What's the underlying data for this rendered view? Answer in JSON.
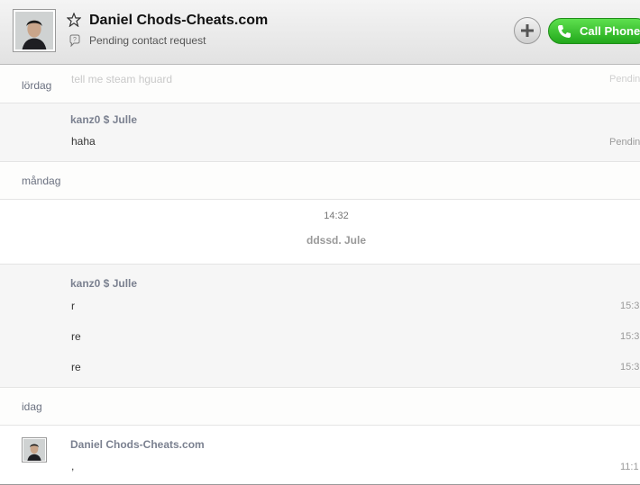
{
  "header": {
    "contact_name": "Daniel Chods-Cheats.com",
    "status": "Pending contact request",
    "call_label": "Call Phone"
  },
  "chat": {
    "day1": {
      "date": "lördag",
      "ghost_message": "tell me steam hguard",
      "ghost_status": "Pending"
    },
    "group1": {
      "sender": "kanz0 $ Julle",
      "message": "haha",
      "status": "Pending"
    },
    "day2": {
      "date": "måndag"
    },
    "event": {
      "time": "14:32",
      "text": "ddssd. Jule"
    },
    "group2": {
      "sender": "kanz0 $ Julle",
      "messages": [
        {
          "text": "r",
          "time": "15:3"
        },
        {
          "text": "re",
          "time": "15:3"
        },
        {
          "text": "re",
          "time": "15:3"
        }
      ]
    },
    "day3": {
      "date": "idag"
    },
    "group3": {
      "sender": "Daniel Chods-Cheats.com",
      "message": ",",
      "time": "11:1"
    }
  }
}
